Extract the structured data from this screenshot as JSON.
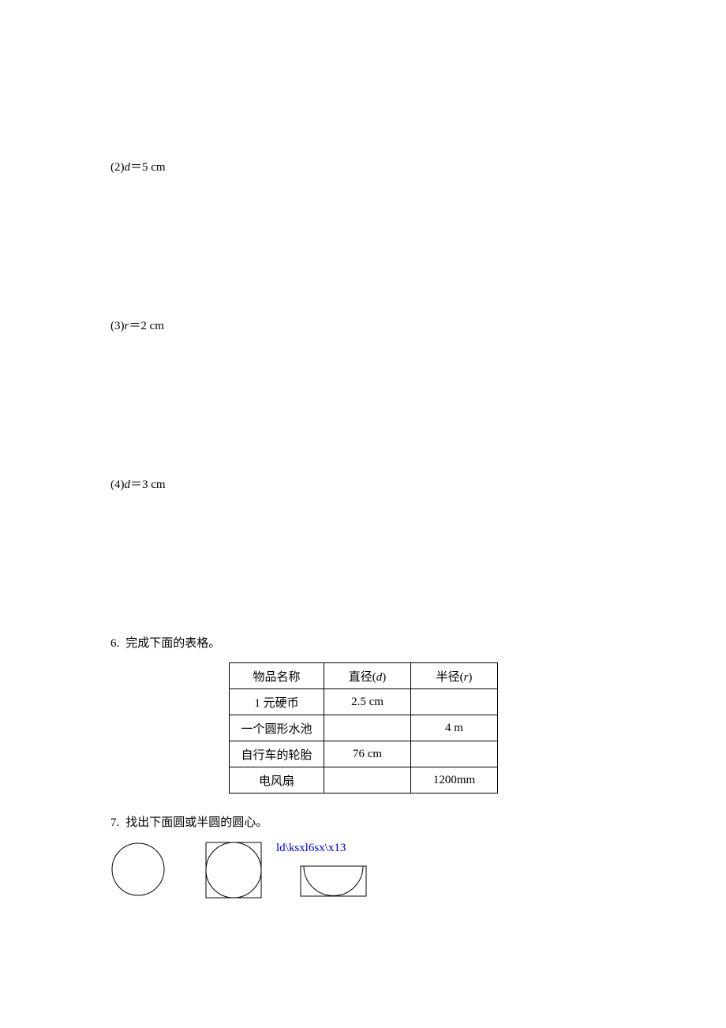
{
  "items": {
    "i2_prefix": "(2)",
    "i2_var": "d",
    "i2_eq": "＝5 cm",
    "i3_prefix": "(3)",
    "i3_var": "r",
    "i3_eq": "＝2 cm",
    "i4_prefix": "(4)",
    "i4_var": "d",
    "i4_eq": "＝3 cm"
  },
  "q6": {
    "num": "6.",
    "label": "完成下面的表格。",
    "headers": {
      "name": "物品名称",
      "d_pre": "直径(",
      "d_var": "d",
      "d_post": ")",
      "r_pre": "半径(",
      "r_var": "r",
      "r_post": ")"
    },
    "rows": [
      {
        "name": "1 元硬币",
        "d": "2.5 cm",
        "r": ""
      },
      {
        "name": "一个圆形水池",
        "d": "",
        "r": "4 m"
      },
      {
        "name": "自行车的轮胎",
        "d": "76 cm",
        "r": ""
      },
      {
        "name": "电风扇",
        "d": "",
        "r": "1200mm"
      }
    ]
  },
  "q7": {
    "num": "7.",
    "label": "找出下面圆或半圆的圆心。",
    "blue_text": "ld\\ksxl6sx\\x13"
  }
}
